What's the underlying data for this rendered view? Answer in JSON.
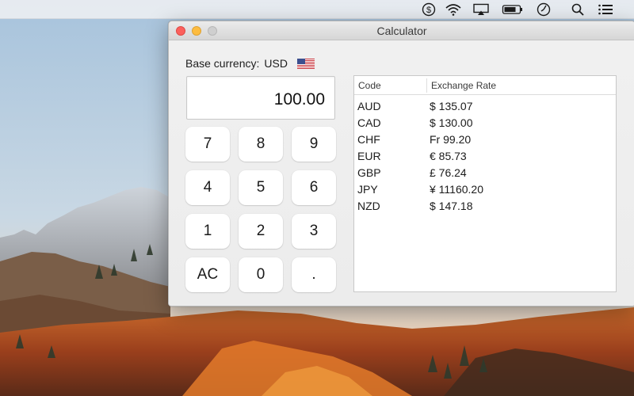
{
  "menubar": {
    "icons": [
      "dollar-icon",
      "wifi-icon",
      "airplay-icon",
      "battery-icon",
      "clock-icon",
      "search-icon",
      "list-icon"
    ]
  },
  "window": {
    "title": "Calculator",
    "base_currency_label": "Base currency:",
    "base_currency_code": "USD",
    "display_value": "100.00",
    "keys": [
      "7",
      "8",
      "9",
      "4",
      "5",
      "6",
      "1",
      "2",
      "3",
      "AC",
      "0",
      "."
    ]
  },
  "table": {
    "headers": [
      "Code",
      "Exchange Rate"
    ],
    "rows": [
      {
        "code": "AUD",
        "rate": "$ 135.07"
      },
      {
        "code": "CAD",
        "rate": "$ 130.00"
      },
      {
        "code": "CHF",
        "rate": "Fr 99.20"
      },
      {
        "code": "EUR",
        "rate": "€ 85.73"
      },
      {
        "code": "GBP",
        "rate": "£ 76.24"
      },
      {
        "code": "JPY",
        "rate": "¥ 11160.20"
      },
      {
        "code": "NZD",
        "rate": "$ 147.18"
      }
    ]
  },
  "colors": {
    "close": "#fc605c",
    "minimize": "#fdbc40",
    "zoom_disabled": "#cfcfcf"
  }
}
